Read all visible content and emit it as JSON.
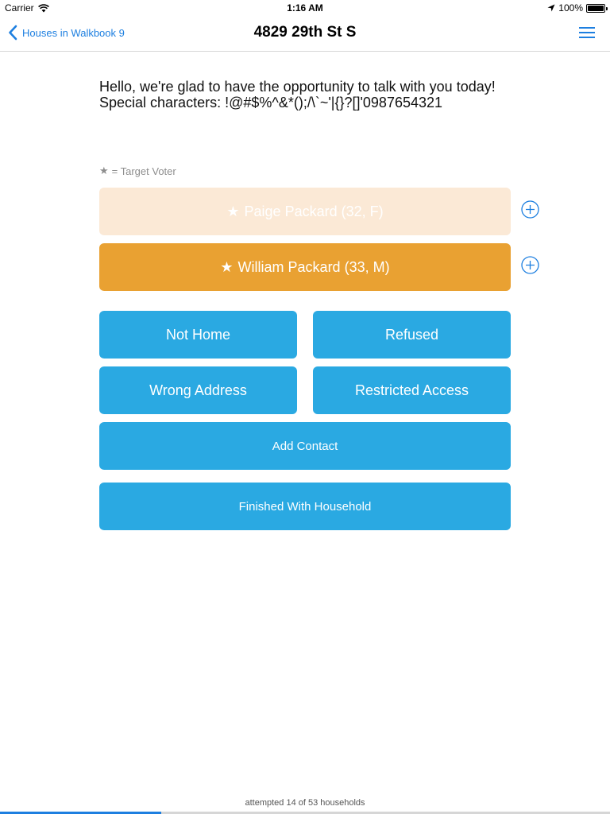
{
  "status_bar": {
    "carrier": "Carrier",
    "time": "1:16 AM",
    "battery_label": "100%",
    "battery_level": 1.0
  },
  "nav": {
    "back_label": "Houses in Walkbook 9",
    "title": "4829 29th St S"
  },
  "script": {
    "text": "Hello, we're glad to have the opportunity to talk with you today!  Special characters: !@#$%^&*();/\\`~'|{}?[]'0987654321"
  },
  "legend": {
    "label": "= Target Voter"
  },
  "people": [
    {
      "label": "Paige Packard (32, F)",
      "color": "#fbe9d6"
    },
    {
      "label": "William Packard (33, M)",
      "color": "#e9a132"
    }
  ],
  "actions": {
    "not_home": "Not Home",
    "refused": "Refused",
    "wrong_address": "Wrong Address",
    "restricted_access": "Restricted Access",
    "add_contact": "Add Contact",
    "finished": "Finished With Household"
  },
  "footer": {
    "progress_text": "attempted 14 of 53 households",
    "attempted": 14,
    "total": 53
  },
  "colors": {
    "accent": "#1d7fe0",
    "button": "#2aa9e2",
    "target_dim": "#fbe9d6",
    "target_active": "#e9a132"
  }
}
